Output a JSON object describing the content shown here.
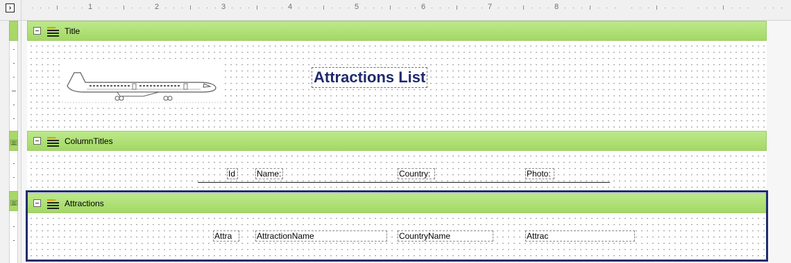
{
  "ruler": {
    "corner_glyph": "›",
    "numbers": [
      "1",
      "2",
      "3",
      "4",
      "5",
      "6",
      "7",
      "8"
    ]
  },
  "bands": {
    "title": {
      "label": "Title",
      "icon": "band-lines-icon"
    },
    "column_titles": {
      "label": "ColumnTitles",
      "icon": "band-lines-icon"
    },
    "attractions": {
      "label": "Attractions",
      "icon": "band-lines-icon"
    }
  },
  "title_area": {
    "heading": "Attractions List",
    "image": "airplane-icon"
  },
  "column_titles_area": {
    "headers": [
      "Id",
      "Name:",
      "Country:",
      "Photo:"
    ]
  },
  "attractions_area": {
    "fields": [
      "Attra",
      "AttractionName",
      "CountryName",
      "Attrac"
    ]
  },
  "colors": {
    "band_green": "#a3d866",
    "selection_border": "#1f2d6e",
    "title_text": "#1f2a6e"
  }
}
